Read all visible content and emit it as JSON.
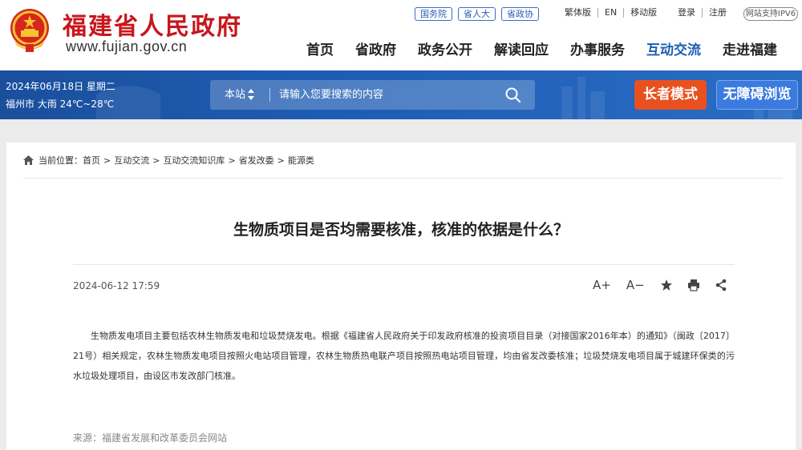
{
  "header": {
    "site_title": "福建省人民政府",
    "site_url": "www.fujian.gov.cn",
    "top_links": [
      "国务院",
      "省人大",
      "省政协"
    ],
    "util_links": [
      "繁体版",
      "EN",
      "移动版"
    ],
    "login_links": [
      "登录",
      "注册"
    ],
    "ipv6_badge": "网站支持IPV6",
    "nav": [
      {
        "label": "首页"
      },
      {
        "label": "省政府"
      },
      {
        "label": "政务公开"
      },
      {
        "label": "解读回应"
      },
      {
        "label": "办事服务"
      },
      {
        "label": "互动交流"
      },
      {
        "label": "走进福建"
      }
    ],
    "active_nav": "互动交流"
  },
  "banner": {
    "date": "2024年06月18日 星期二",
    "weather": "福州市 大雨 24℃~28℃",
    "search_scope": "本站",
    "search_placeholder": "请输入您要搜索的内容",
    "elder_mode": "长者模式",
    "accessible": "无障碍浏览"
  },
  "breadcrumb": {
    "prefix": "当前位置：",
    "items": [
      "首页",
      "互动交流",
      "互动交流知识库",
      "省发改委",
      "能源类"
    ],
    "separator": ">"
  },
  "article": {
    "title": "生物质项目是否均需要核准，核准的依据是什么？",
    "date": "2024-06-12 17:59",
    "font_increase": "A+",
    "font_decrease": "A−",
    "body": "生物质发电项目主要包括农林生物质发电和垃圾焚烧发电。根据《福建省人民政府关于印发政府核准的投资项目目录（对接国家2016年本）的通知》（闽政〔2017〕21号）相关规定，农林生物质发电项目按照火电站项目管理，农林生物质热电联产项目按照热电站项目管理，均由省发改委核准；垃圾焚烧发电项目属于城建环保类的污水垃圾处理项目，由设区市发改部门核准。",
    "source": "来源：福建省发展和改革委员会网站"
  },
  "colors": {
    "brand_red": "#c8161d",
    "nav_active": "#1d5fb5",
    "banner_blue": "#1e5cb3",
    "elder_orange": "#e8511f"
  }
}
